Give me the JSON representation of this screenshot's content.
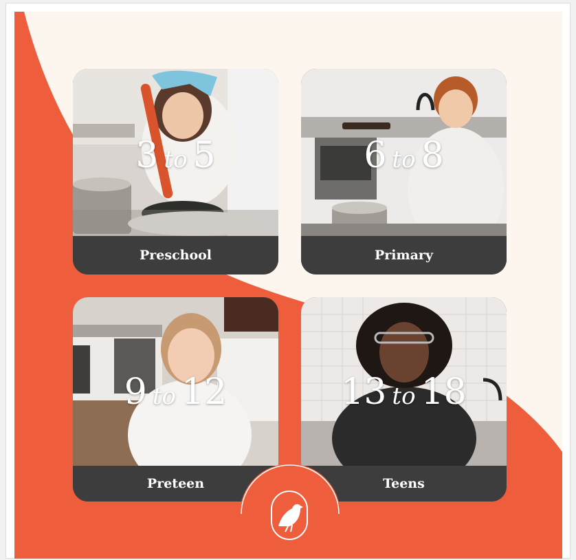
{
  "colors": {
    "background": "#fdf6ef",
    "accent": "#ee5e3c",
    "card_bar": "#3d3d3d",
    "text_light": "#ffffff"
  },
  "cards": [
    {
      "age_from": "3",
      "to_word": "to",
      "age_to": "5",
      "label": "Preschool"
    },
    {
      "age_from": "6",
      "to_word": "to",
      "age_to": "8",
      "label": "Primary"
    },
    {
      "age_from": "9",
      "to_word": "to",
      "age_to": "12",
      "label": "Preteen"
    },
    {
      "age_from": "13",
      "to_word": "to",
      "age_to": "18",
      "label": "Teens"
    }
  ],
  "badge": {
    "icon": "bird-icon"
  }
}
